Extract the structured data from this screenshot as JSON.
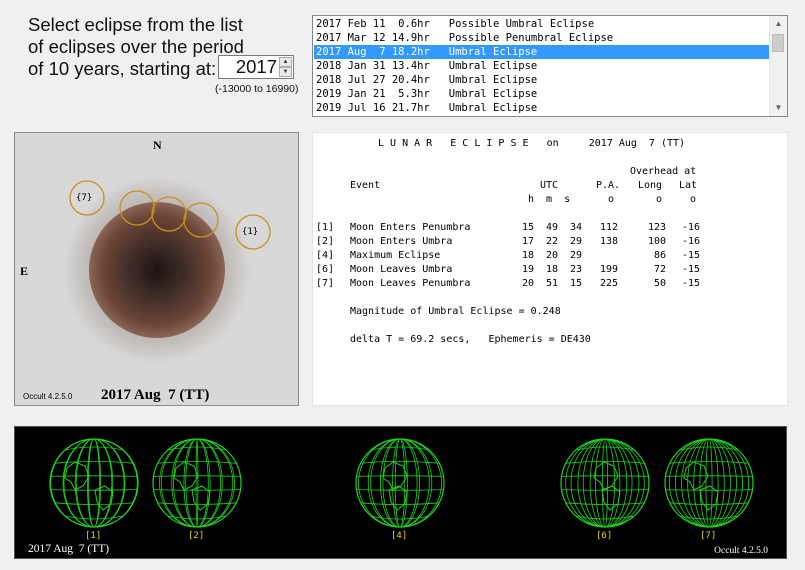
{
  "prompt": {
    "line1": "Select eclipse from the list",
    "line2": "of eclipses over the period",
    "line3": "of 10 years, starting at:",
    "year": "2017",
    "range": "(-13000 to 16990)"
  },
  "eclipse_list": [
    {
      "text": "2017 Feb 11  0.6hr   Possible Umbral Eclipse",
      "selected": false
    },
    {
      "text": "2017 Mar 12 14.9hr   Possible Penumbral Eclipse",
      "selected": false
    },
    {
      "text": "2017 Aug  7 18.2hr   Umbral Eclipse",
      "selected": true
    },
    {
      "text": "2018 Jan 31 13.4hr   Umbral Eclipse",
      "selected": false
    },
    {
      "text": "2018 Jul 27 20.4hr   Umbral Eclipse",
      "selected": false
    },
    {
      "text": "2019 Jan 21  5.3hr   Umbral Eclipse",
      "selected": false
    },
    {
      "text": "2019 Jul 16 21.7hr   Umbral Eclipse",
      "selected": false
    }
  ],
  "diagram": {
    "north": "N",
    "east": "E",
    "contact_first": "{1}",
    "contact_last": "{7}",
    "version": "Occult 4.2.5.0",
    "date": "2017 Aug  7 (TT)"
  },
  "report": {
    "title": "L U N A R   E C L I P S E   on     2017 Aug  7 (TT)",
    "header_overhead": "Overhead at",
    "header_event": "Event",
    "header_utc": "UTC",
    "header_pa": "P.A.",
    "header_long": "Long",
    "header_lat": "Lat",
    "unit_hms": "h  m  s",
    "unit_pa": "o",
    "unit_long": "o",
    "unit_lat": "o",
    "events": [
      {
        "id": "[1]",
        "name": "Moon Enters Penumbra",
        "h": "15",
        "m": "49",
        "s": "34",
        "pa": "112",
        "long": "123",
        "lat": "-16"
      },
      {
        "id": "[2]",
        "name": "Moon Enters Umbra",
        "h": "17",
        "m": "22",
        "s": "29",
        "pa": "138",
        "long": "100",
        "lat": "-16"
      },
      {
        "id": "[4]",
        "name": "Maximum Eclipse",
        "h": "18",
        "m": "20",
        "s": "29",
        "pa": "",
        "long": "86",
        "lat": "-15"
      },
      {
        "id": "[6]",
        "name": "Moon Leaves Umbra",
        "h": "19",
        "m": "18",
        "s": "23",
        "pa": "199",
        "long": "72",
        "lat": "-15"
      },
      {
        "id": "[7]",
        "name": "Moon Leaves Penumbra",
        "h": "20",
        "m": "51",
        "s": "15",
        "pa": "225",
        "long": "50",
        "lat": "-15"
      }
    ],
    "magnitude": "Magnitude of Umbral Eclipse = 0.248",
    "delta_t": "delta T = 69.2 secs,   Ephemeris = DE430"
  },
  "globes": {
    "items": [
      {
        "label": "[1]"
      },
      {
        "label": "[2]"
      },
      {
        "label": "[4]"
      },
      {
        "label": "[6]"
      },
      {
        "label": "[7]"
      }
    ],
    "date": "2017 Aug  7 (TT)",
    "version": "Occult 4.2.5.0"
  },
  "colors": {
    "selection": "#3399ff",
    "contact_circle": "#c8901e",
    "globe_grid": "#21d321",
    "globe_label": "#e6d800"
  }
}
